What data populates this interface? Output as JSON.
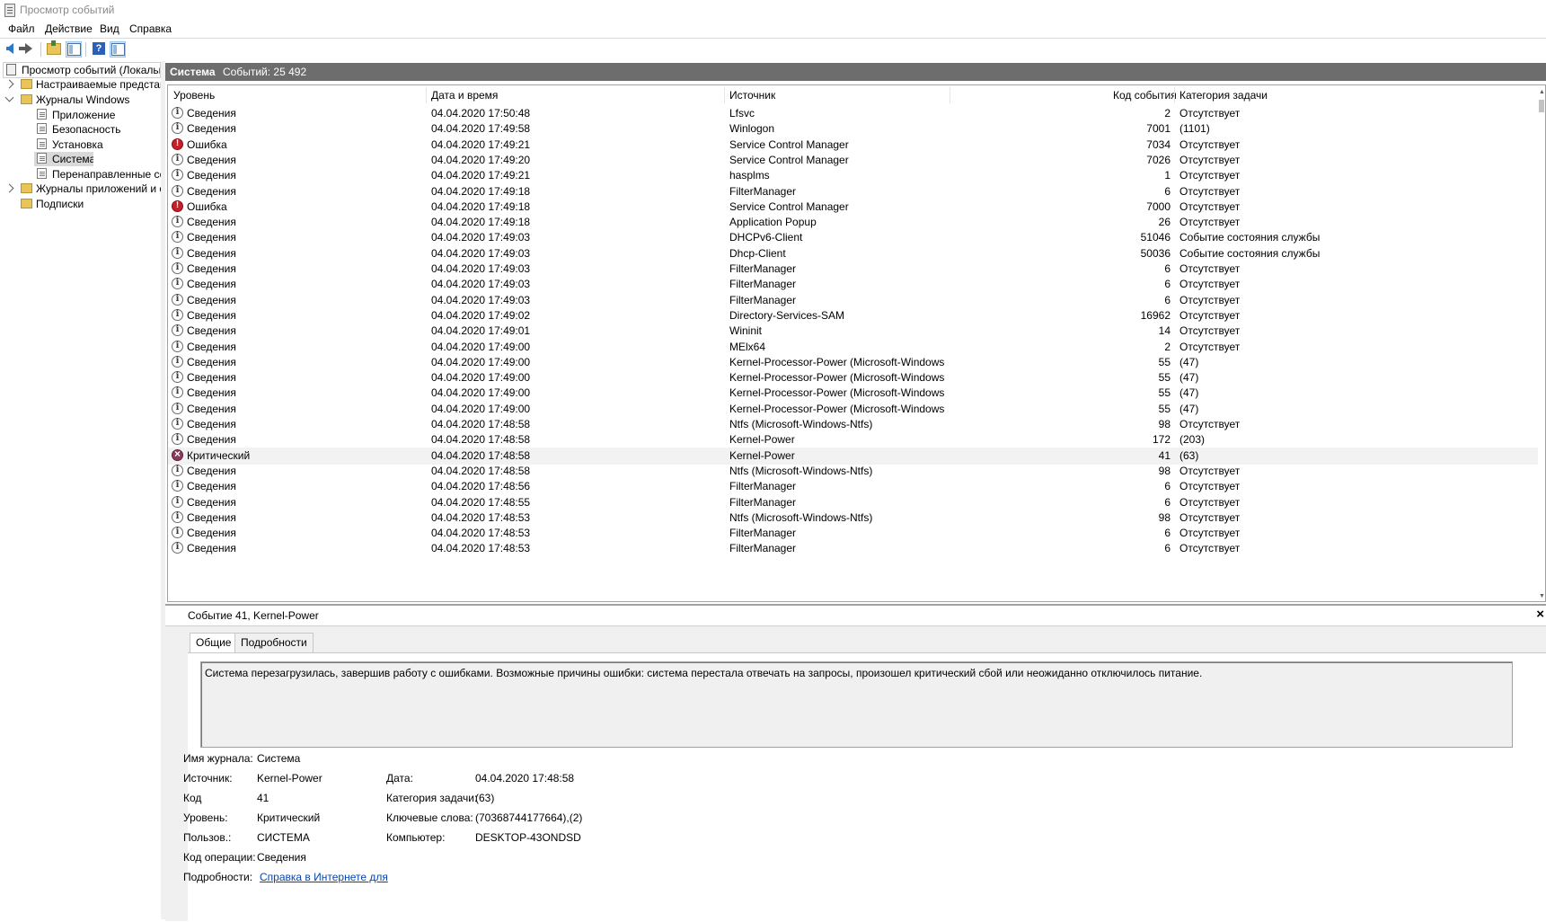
{
  "window": {
    "title": "Просмотр событий"
  },
  "menu": [
    "Файл",
    "Действие",
    "Вид",
    "Справка"
  ],
  "tree": {
    "root": "Просмотр событий (Локальный)",
    "custom_views": "Настраиваемые представления",
    "windows_logs": "Журналы Windows",
    "application": "Приложение",
    "security": "Безопасность",
    "setup": "Установка",
    "system": "Система",
    "forwarded": "Перенаправленные события",
    "apps_services": "Журналы приложений и служб",
    "subscriptions": "Подписки"
  },
  "main": {
    "log_name": "Система",
    "count_label": "Событий: 25 492"
  },
  "columns": {
    "level": "Уровень",
    "datetime": "Дата и время",
    "source": "Источник",
    "event_id": "Код события",
    "task_category": "Категория задачи"
  },
  "events": [
    {
      "level_icon": "info-icon",
      "level": "Сведения",
      "datetime": "04.04.2020 17:50:48",
      "source": "Lfsvc",
      "id": "2",
      "category": "Отсутствует"
    },
    {
      "level_icon": "info-icon",
      "level": "Сведения",
      "datetime": "04.04.2020 17:49:58",
      "source": "Winlogon",
      "id": "7001",
      "category": "(1101)"
    },
    {
      "level_icon": "error-icon",
      "level": "Ошибка",
      "datetime": "04.04.2020 17:49:21",
      "source": "Service Control Manager",
      "id": "7034",
      "category": "Отсутствует"
    },
    {
      "level_icon": "info-icon",
      "level": "Сведения",
      "datetime": "04.04.2020 17:49:20",
      "source": "Service Control Manager",
      "id": "7026",
      "category": "Отсутствует"
    },
    {
      "level_icon": "info-icon",
      "level": "Сведения",
      "datetime": "04.04.2020 17:49:21",
      "source": "hasplms",
      "id": "1",
      "category": "Отсутствует"
    },
    {
      "level_icon": "info-icon",
      "level": "Сведения",
      "datetime": "04.04.2020 17:49:18",
      "source": "FilterManager",
      "id": "6",
      "category": "Отсутствует"
    },
    {
      "level_icon": "error-icon",
      "level": "Ошибка",
      "datetime": "04.04.2020 17:49:18",
      "source": "Service Control Manager",
      "id": "7000",
      "category": "Отсутствует"
    },
    {
      "level_icon": "info-icon",
      "level": "Сведения",
      "datetime": "04.04.2020 17:49:18",
      "source": "Application Popup",
      "id": "26",
      "category": "Отсутствует"
    },
    {
      "level_icon": "info-icon",
      "level": "Сведения",
      "datetime": "04.04.2020 17:49:03",
      "source": "DHCPv6-Client",
      "id": "51046",
      "category": "Событие состояния службы"
    },
    {
      "level_icon": "info-icon",
      "level": "Сведения",
      "datetime": "04.04.2020 17:49:03",
      "source": "Dhcp-Client",
      "id": "50036",
      "category": "Событие состояния службы"
    },
    {
      "level_icon": "info-icon",
      "level": "Сведения",
      "datetime": "04.04.2020 17:49:03",
      "source": "FilterManager",
      "id": "6",
      "category": "Отсутствует"
    },
    {
      "level_icon": "info-icon",
      "level": "Сведения",
      "datetime": "04.04.2020 17:49:03",
      "source": "FilterManager",
      "id": "6",
      "category": "Отсутствует"
    },
    {
      "level_icon": "info-icon",
      "level": "Сведения",
      "datetime": "04.04.2020 17:49:03",
      "source": "FilterManager",
      "id": "6",
      "category": "Отсутствует"
    },
    {
      "level_icon": "info-icon",
      "level": "Сведения",
      "datetime": "04.04.2020 17:49:02",
      "source": "Directory-Services-SAM",
      "id": "16962",
      "category": "Отсутствует"
    },
    {
      "level_icon": "info-icon",
      "level": "Сведения",
      "datetime": "04.04.2020 17:49:01",
      "source": "Wininit",
      "id": "14",
      "category": "Отсутствует"
    },
    {
      "level_icon": "info-icon",
      "level": "Сведения",
      "datetime": "04.04.2020 17:49:00",
      "source": "MElx64",
      "id": "2",
      "category": "Отсутствует"
    },
    {
      "level_icon": "info-icon",
      "level": "Сведения",
      "datetime": "04.04.2020 17:49:00",
      "source": "Kernel-Processor-Power (Microsoft-Windows-K...",
      "id": "55",
      "category": "(47)"
    },
    {
      "level_icon": "info-icon",
      "level": "Сведения",
      "datetime": "04.04.2020 17:49:00",
      "source": "Kernel-Processor-Power (Microsoft-Windows-K...",
      "id": "55",
      "category": "(47)"
    },
    {
      "level_icon": "info-icon",
      "level": "Сведения",
      "datetime": "04.04.2020 17:49:00",
      "source": "Kernel-Processor-Power (Microsoft-Windows-K...",
      "id": "55",
      "category": "(47)"
    },
    {
      "level_icon": "info-icon",
      "level": "Сведения",
      "datetime": "04.04.2020 17:49:00",
      "source": "Kernel-Processor-Power (Microsoft-Windows-K...",
      "id": "55",
      "category": "(47)"
    },
    {
      "level_icon": "info-icon",
      "level": "Сведения",
      "datetime": "04.04.2020 17:48:58",
      "source": "Ntfs (Microsoft-Windows-Ntfs)",
      "id": "98",
      "category": "Отсутствует"
    },
    {
      "level_icon": "info-icon",
      "level": "Сведения",
      "datetime": "04.04.2020 17:48:58",
      "source": "Kernel-Power",
      "id": "172",
      "category": "(203)"
    },
    {
      "level_icon": "critical-icon",
      "level": "Критический",
      "datetime": "04.04.2020 17:48:58",
      "source": "Kernel-Power",
      "id": "41",
      "category": "(63)",
      "selected": true
    },
    {
      "level_icon": "info-icon",
      "level": "Сведения",
      "datetime": "04.04.2020 17:48:58",
      "source": "Ntfs (Microsoft-Windows-Ntfs)",
      "id": "98",
      "category": "Отсутствует"
    },
    {
      "level_icon": "info-icon",
      "level": "Сведения",
      "datetime": "04.04.2020 17:48:56",
      "source": "FilterManager",
      "id": "6",
      "category": "Отсутствует"
    },
    {
      "level_icon": "info-icon",
      "level": "Сведения",
      "datetime": "04.04.2020 17:48:55",
      "source": "FilterManager",
      "id": "6",
      "category": "Отсутствует"
    },
    {
      "level_icon": "info-icon",
      "level": "Сведения",
      "datetime": "04.04.2020 17:48:53",
      "source": "Ntfs (Microsoft-Windows-Ntfs)",
      "id": "98",
      "category": "Отсутствует"
    },
    {
      "level_icon": "info-icon",
      "level": "Сведения",
      "datetime": "04.04.2020 17:48:53",
      "source": "FilterManager",
      "id": "6",
      "category": "Отсутствует"
    },
    {
      "level_icon": "info-icon",
      "level": "Сведения",
      "datetime": "04.04.2020 17:48:53",
      "source": "FilterManager",
      "id": "6",
      "category": "Отсутствует"
    }
  ],
  "details": {
    "title": "Событие 41, Kernel-Power",
    "tabs": [
      "Общие",
      "Подробности"
    ],
    "description": "Система перезагрузилась, завершив работу с ошибками. Возможные причины ошибки: система перестала отвечать на запросы, произошел критический сбой или неожиданно отключилось питание.",
    "fields": {
      "log_name_label": "Имя журнала:",
      "log_name": "Система",
      "source_label": "Источник:",
      "source": "Kernel-Power",
      "date_label": "Дата:",
      "date": "04.04.2020 17:48:58",
      "code_label": "Код",
      "code": "41",
      "task_label": "Категория задачи:",
      "task": "(63)",
      "level_label": "Уровень:",
      "level": "Критический",
      "keywords_label": "Ключевые слова:",
      "keywords": "(70368744177664),(2)",
      "user_label": "Пользов.:",
      "user": "СИСТЕМА",
      "computer_label": "Компьютер:",
      "computer": "DESKTOP-43ONDSD",
      "opcode_label": "Код операции:",
      "opcode": "Сведения",
      "more_label": "Подробности:",
      "more_link": "Справка в Интернете для"
    }
  }
}
